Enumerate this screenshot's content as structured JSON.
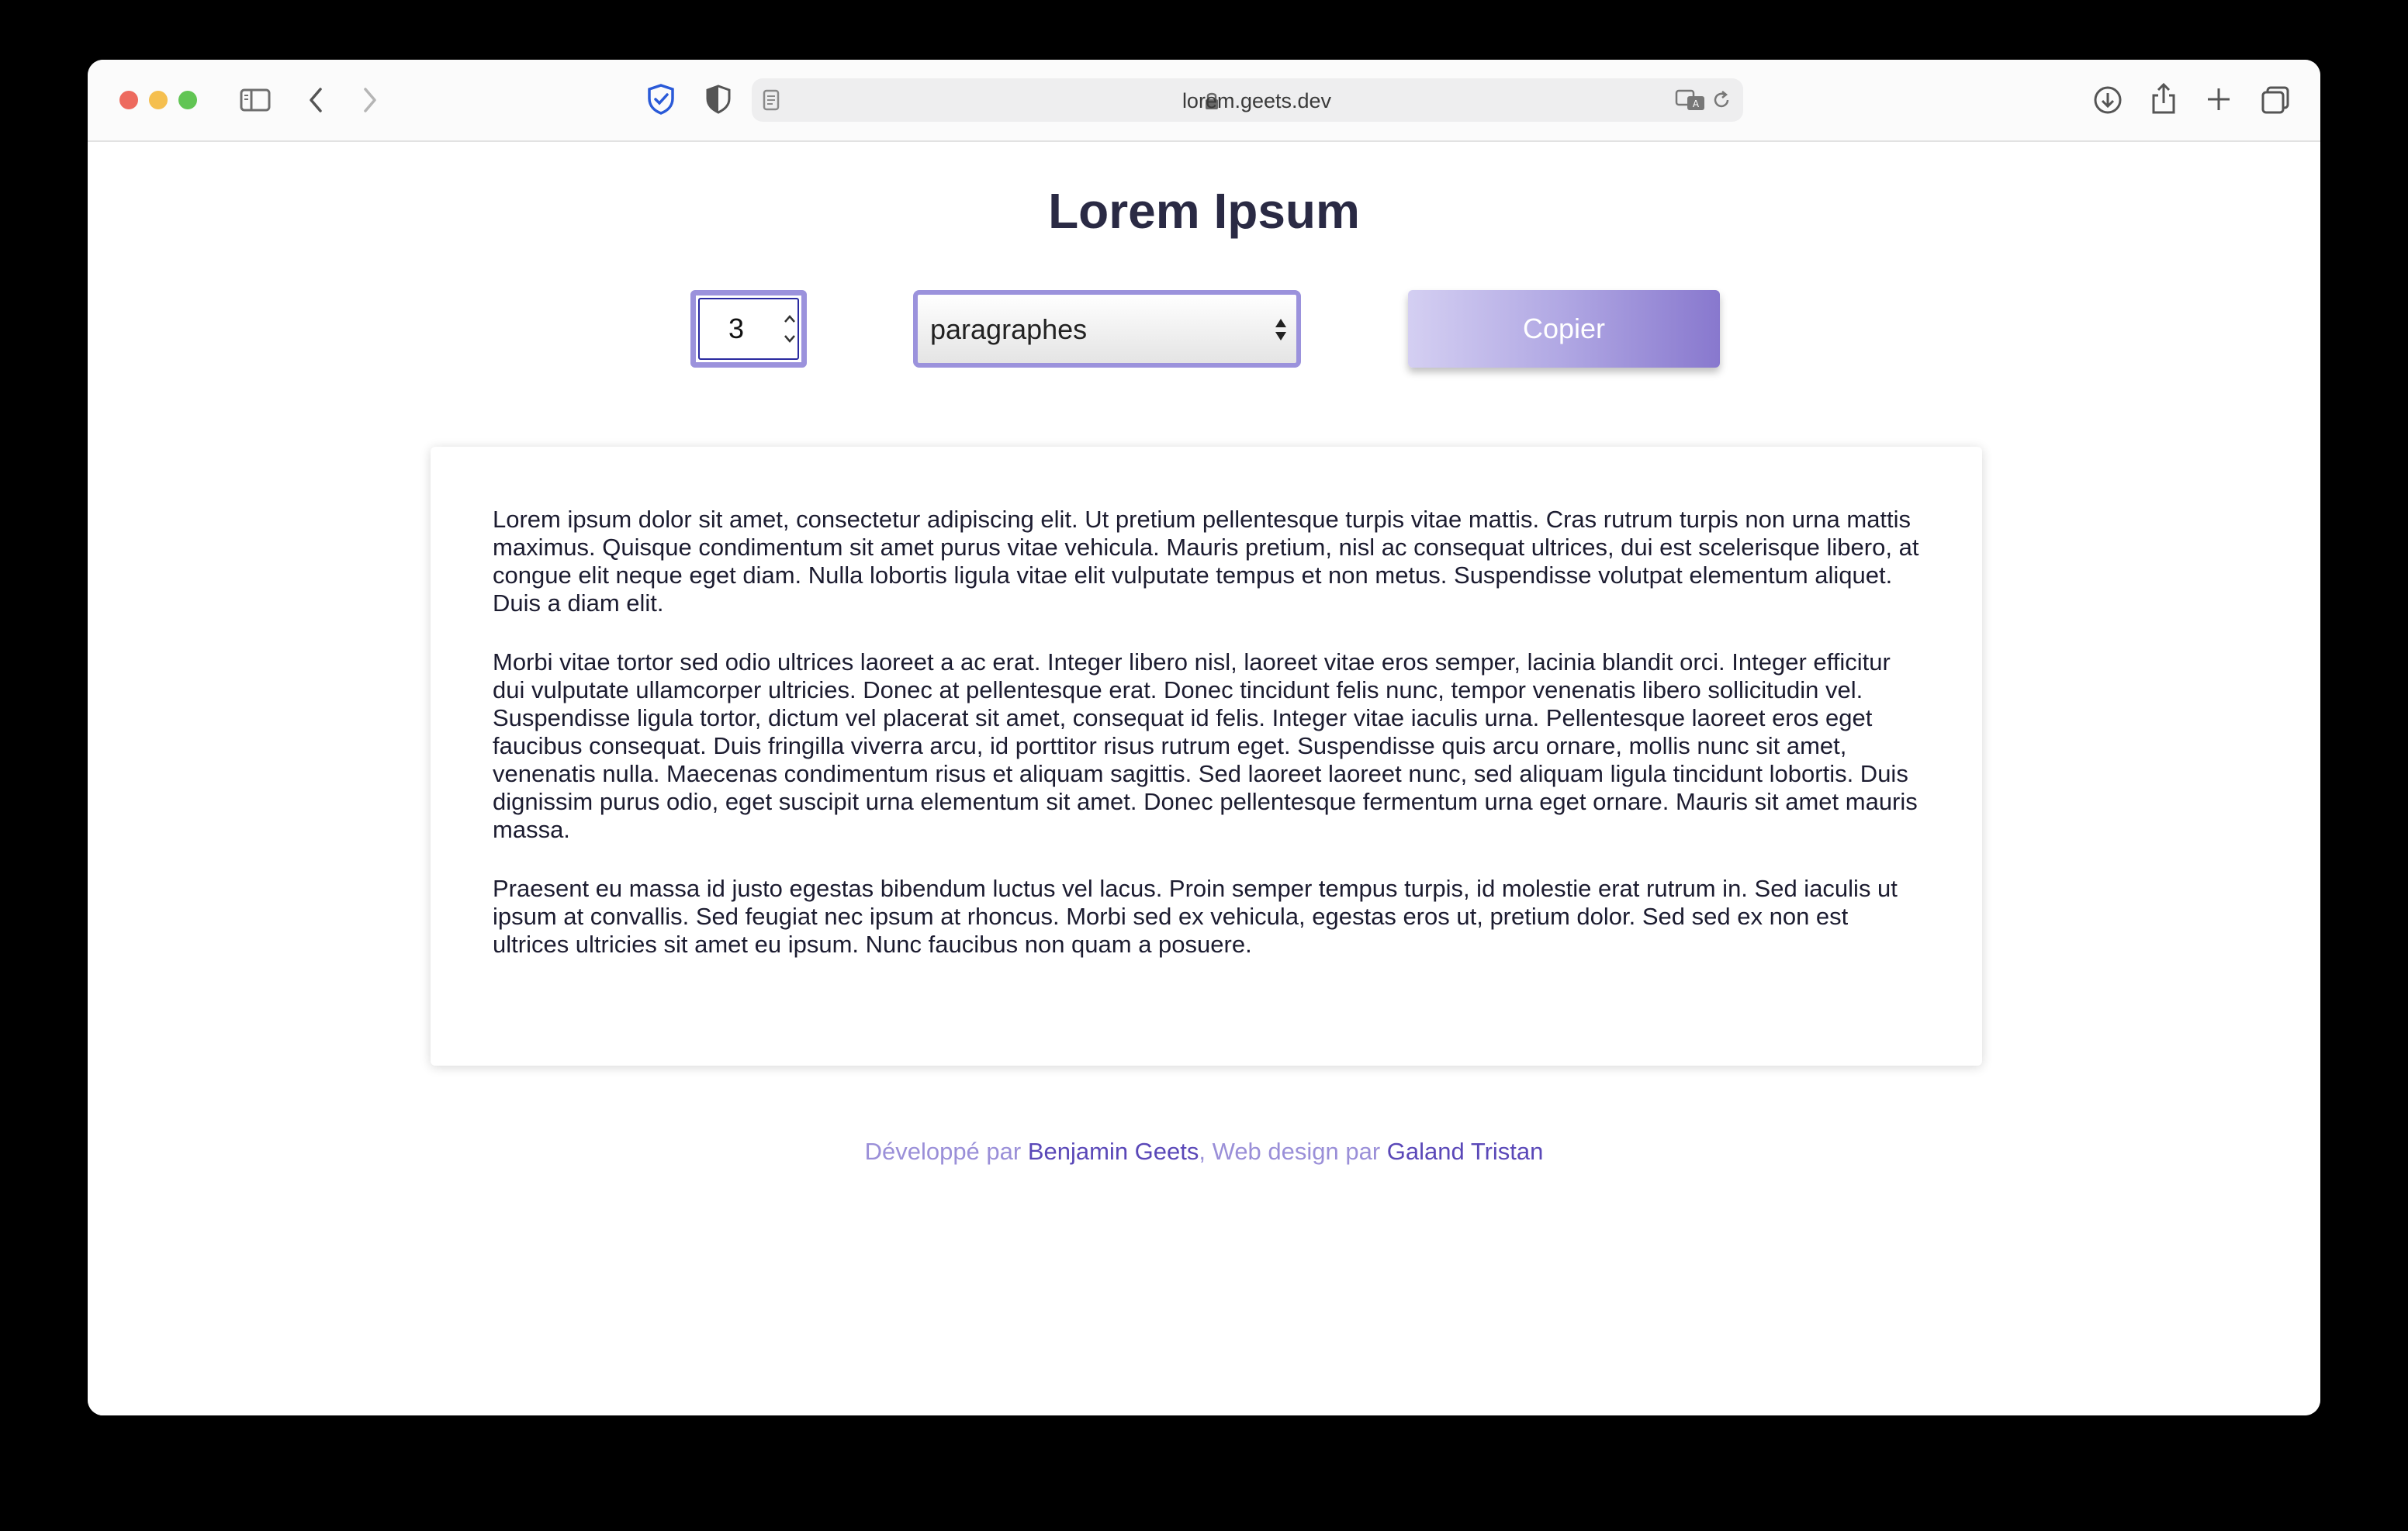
{
  "browser": {
    "url": "lorem.geets.dev"
  },
  "page": {
    "title": "Lorem Ipsum",
    "count_value": "3",
    "unit_select": "paragraphes",
    "copy_label": "Copier",
    "paragraphs": [
      "Lorem ipsum dolor sit amet, consectetur adipiscing elit. Ut pretium pellentesque turpis vitae mattis. Cras rutrum turpis non urna mattis maximus. Quisque condimentum sit amet purus vitae vehicula. Mauris pretium, nisl ac consequat ultrices, dui est scelerisque libero, at congue elit neque eget diam. Nulla lobortis ligula vitae elit vulputate tempus et non metus. Suspendisse volutpat elementum aliquet. Duis a diam elit.",
      "Morbi vitae tortor sed odio ultrices laoreet a ac erat. Integer libero nisl, laoreet vitae eros semper, lacinia blandit orci. Integer efficitur dui vulputate ullamcorper ultricies. Donec at pellentesque erat. Donec tincidunt felis nunc, tempor venenatis libero sollicitudin vel. Suspendisse ligula tortor, dictum vel placerat sit amet, consequat id felis. Integer vitae iaculis urna. Pellentesque laoreet eros eget faucibus consequat. Duis fringilla viverra arcu, id porttitor risus rutrum eget. Suspendisse quis arcu ornare, mollis nunc sit amet, venenatis nulla. Maecenas condimentum risus et aliquam sagittis. Sed laoreet laoreet nunc, sed aliquam ligula tincidunt lobortis. Duis dignissim purus odio, eget suscipit urna elementum sit amet. Donec pellentesque fermentum urna eget ornare. Mauris sit amet mauris massa.",
      "Praesent eu massa id justo egestas bibendum luctus vel lacus. Proin semper tempus turpis, id molestie erat rutrum in. Sed iaculis ut ipsum at convallis. Sed feugiat nec ipsum at rhoncus. Morbi sed ex vehicula, egestas eros ut, pretium dolor. Sed sed ex non est ultrices ultricies sit amet eu ipsum. Nunc faucibus non quam a posuere."
    ]
  },
  "footer": {
    "dev_prefix": "Développé par ",
    "dev_name": "Benjamin Geets",
    "design_prefix": ", Web design par ",
    "design_name": "Galand Tristan"
  },
  "colors": {
    "accent": "#9b92dc",
    "link": "#5a48b8",
    "footer_text": "#9a8fd8",
    "title": "#2a2a44"
  },
  "icons": [
    "sidebar-icon",
    "back-icon",
    "forward-icon",
    "privacy-shield-icon",
    "shield-half-icon",
    "reader-icon",
    "lock-icon",
    "translate-icon",
    "reload-icon",
    "download-icon",
    "share-icon",
    "new-tab-icon",
    "tabs-overview-icon"
  ]
}
